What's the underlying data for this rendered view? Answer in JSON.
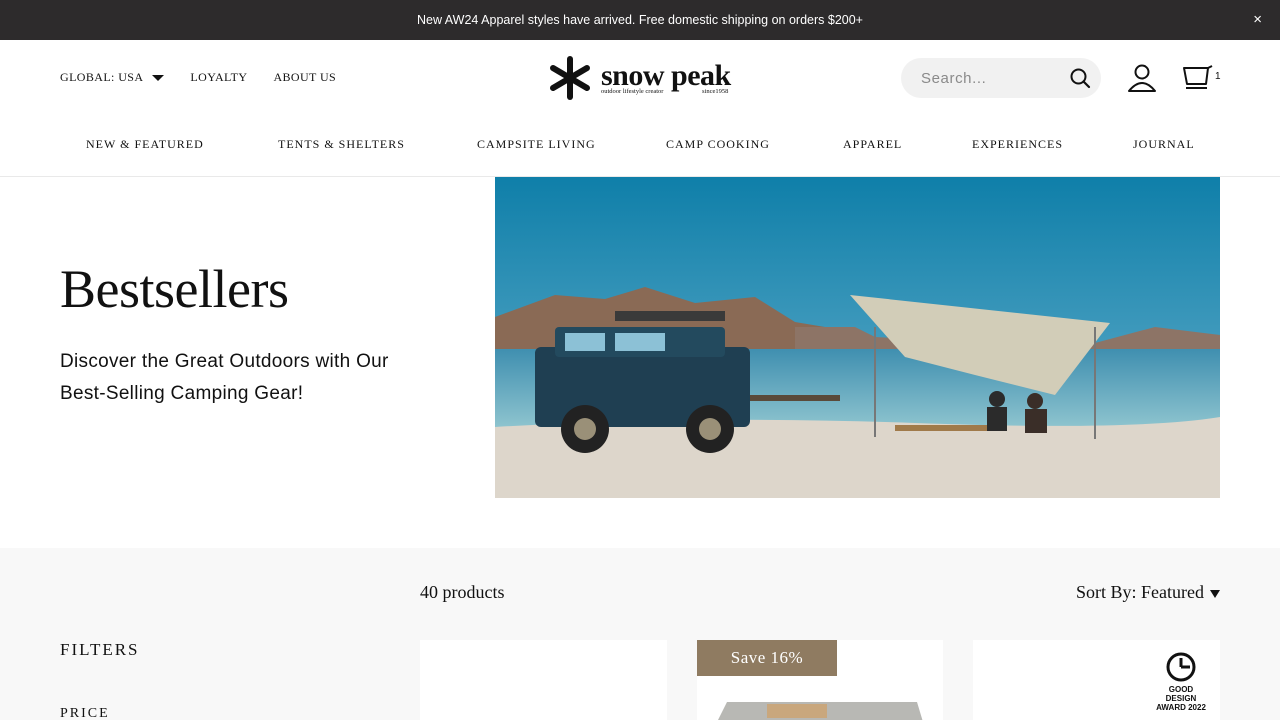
{
  "announcement": {
    "text": "New AW24 Apparel styles have arrived. Free domestic shipping on orders $200+",
    "close": "×"
  },
  "header": {
    "region": "GLOBAL: USA",
    "loyalty": "LOYALTY",
    "about": "ABOUT US",
    "logo_word": "snow peak",
    "logo_tagline": "outdoor lifestyle creator",
    "logo_since": "since1958",
    "search_placeholder": "Search...",
    "cart_count": "1"
  },
  "nav": [
    "NEW & FEATURED",
    "TENTS & SHELTERS",
    "CAMPSITE LIVING",
    "CAMP COOKING",
    "APPAREL",
    "EXPERIENCES",
    "JOURNAL"
  ],
  "hero": {
    "title": "Bestsellers",
    "subtitle": "Discover the Great Outdoors with Our Best-Selling Camping Gear!"
  },
  "listing": {
    "product_count": "40 products",
    "sort_label": "Sort By: Featured",
    "filters_title": "FILTERS",
    "price_label": "PRICE",
    "cards": [
      {
        "badge": ""
      },
      {
        "badge": "Save 16%"
      },
      {
        "badge_line1": "GOOD DESIGN",
        "badge_line2": "AWARD 2022"
      }
    ]
  },
  "colors": {
    "announcement_bg": "#2d2b2c",
    "save_badge": "#8f7b61",
    "listing_bg": "#f8f8f8"
  }
}
